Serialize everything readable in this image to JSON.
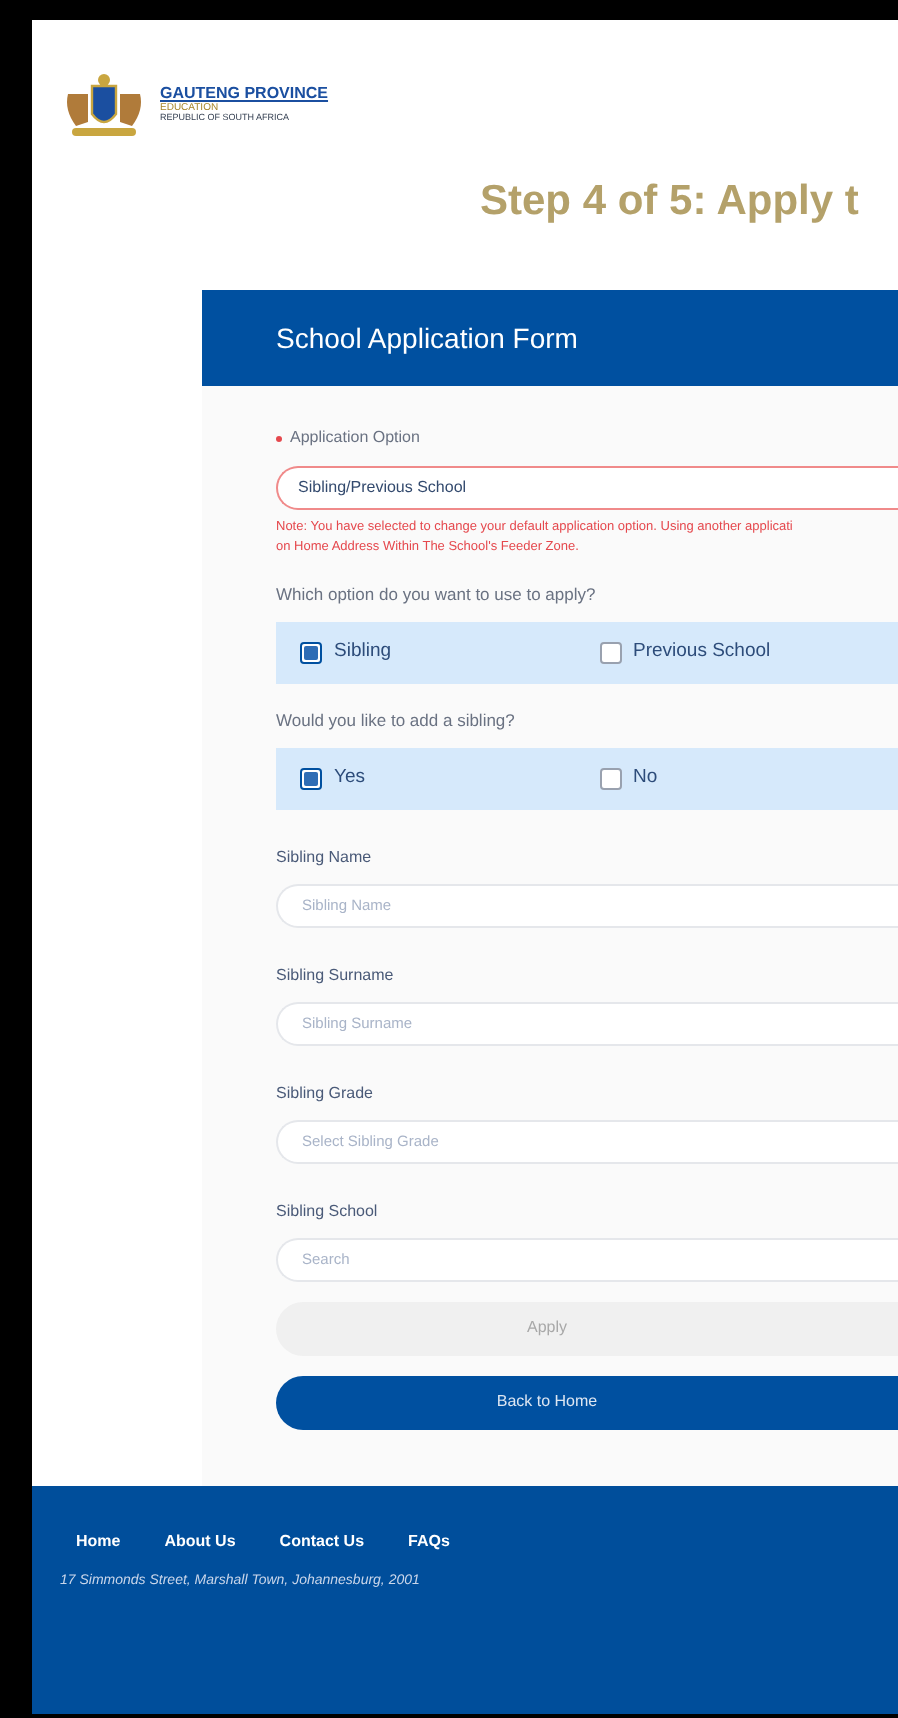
{
  "logo": {
    "title": "GAUTENG PROVINCE",
    "subtitle": "EDUCATION",
    "country": "REPUBLIC OF SOUTH AFRICA"
  },
  "page_title": "Step 4 of 5: Apply t",
  "form": {
    "title": "School Application Form",
    "application_option": {
      "label": "Application Option",
      "required": true,
      "value": "Sibling/Previous School",
      "note_lines": [
        "Note: You have selected to change your default application option. Using another applicati",
        "on Home Address Within The School's Feeder Zone."
      ]
    },
    "questions": [
      {
        "label": "Which option do you want to use to apply?",
        "options": [
          {
            "label": "Sibling",
            "selected": true
          },
          {
            "label": "Previous School",
            "selected": false
          }
        ]
      },
      {
        "label": "Would you like to add a sibling?",
        "options": [
          {
            "label": "Yes",
            "selected": true
          },
          {
            "label": "No",
            "selected": false
          }
        ]
      }
    ],
    "fields": [
      {
        "label": "Sibling Name",
        "placeholder": "Sibling Name"
      },
      {
        "label": "Sibling Surname",
        "placeholder": "Sibling Surname"
      },
      {
        "label": "Sibling Grade",
        "placeholder": "Select Sibling Grade"
      },
      {
        "label": "Sibling School",
        "placeholder": "Search"
      }
    ],
    "buttons": [
      {
        "label": "Apply",
        "disabled": true
      },
      {
        "label": "Back to Home",
        "disabled": false
      }
    ]
  },
  "footer": {
    "links": [
      "Home",
      "About Us",
      "Contact Us",
      "FAQs"
    ],
    "address": "17 Simmonds Street, Marshall Town, Johannesburg, 2001"
  }
}
